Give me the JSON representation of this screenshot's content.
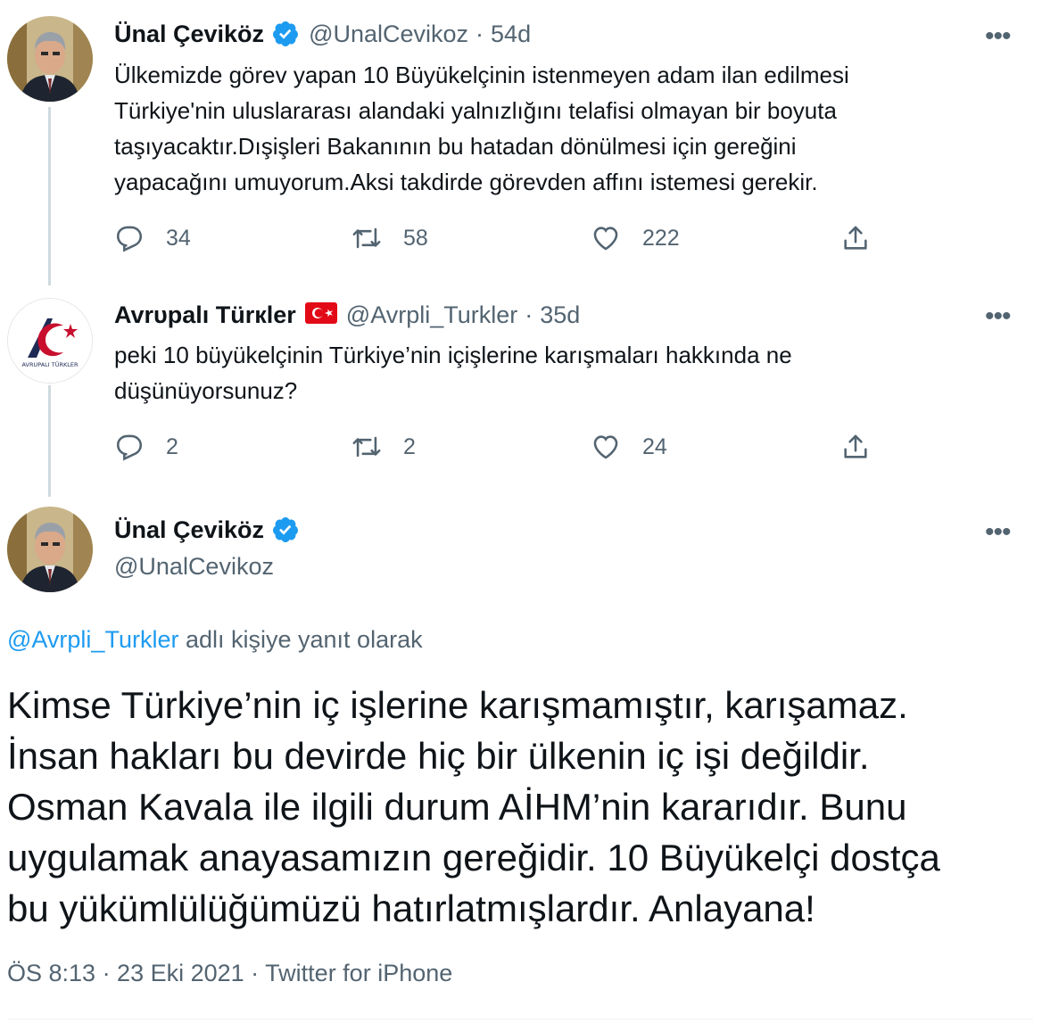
{
  "tweet1": {
    "name": "Ünal Çeviköz",
    "handle": "@UnalCevikoz",
    "time": "54d",
    "text": "Ülkemizde görev yapan 10 Büyükelçinin istenmeyen adam ilan edilmesi\nTürkiye'nin uluslararası alandaki yalnızlığını telafisi olmayan bir boyuta\ntaşıyacaktır.Dışişleri Bakanının bu hatadan dönülmesi için gereğini\nyapacağını  umuyorum.Aksi takdirde görevden affını istemesi gerekir.",
    "replies": "34",
    "retweets": "58",
    "likes": "222"
  },
  "tweet2": {
    "name": "Avrυpalı Türкler",
    "handle": "@Avrpli_Turkler",
    "time": "35d",
    "text": "peki 10 büyükelçinin Türkiye’nin içişlerine karışmaları hakkında ne\ndüşünüyorsunuz?",
    "replies": "2",
    "retweets": "2",
    "likes": "24",
    "logo_text": "AVRUPALI TÜRKLER"
  },
  "tweet3": {
    "name": "Ünal Çeviköz",
    "handle": "@UnalCevikoz",
    "reply_to_handle": "@Avrpli_Turkler",
    "reply_to_suffix": " adlı kişiye yanıt olarak",
    "text": "Kimse Türkiye’nin iç işlerine karışmamıştır, karışamaz.\nİnsan hakları bu devirde hiç bir ülkenin iç işi değildir.\nOsman Kavala ile ilgili durum AİHM’nin kararıdır. Bunu\nuygulamak anayasamızın gereğidir. 10 Büyükelçi dostça\nbu yükümlülüğümüzü hatırlatmışlardır. Anlayana!",
    "meta": "ÖS 8:13 · 23 Eki 2021 · Twitter for iPhone"
  },
  "separator": "·",
  "more_glyph": "•••",
  "colors": {
    "text": "#0f1419",
    "secondary": "#536471",
    "link": "#1d9bf0",
    "verified": "#1d9bf0",
    "thread_line": "#cfd9de",
    "flag_red": "#e30a17"
  }
}
